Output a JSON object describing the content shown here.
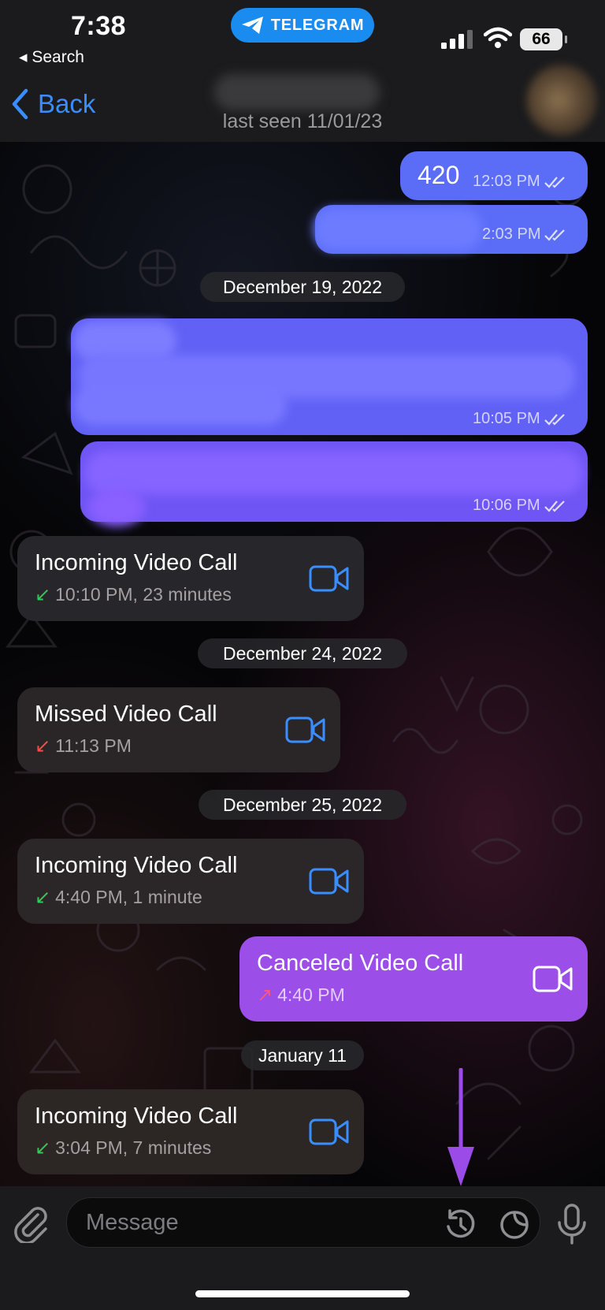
{
  "status_bar": {
    "time": "7:38",
    "back_app": "◂ Search",
    "app_pill": "TELEGRAM",
    "battery": "66"
  },
  "nav": {
    "back_label": "Back",
    "last_seen": "last seen 11/01/23"
  },
  "messages": {
    "m1": {
      "text": "420",
      "time": "12:03 PM"
    },
    "m2": {
      "time": "2:03 PM"
    },
    "m3": {
      "time": "10:05 PM"
    },
    "m4": {
      "time": "10:06 PM"
    }
  },
  "dates": [
    "December 19, 2022",
    "December 24, 2022",
    "December 25, 2022",
    "January 11"
  ],
  "calls": [
    {
      "title": "Incoming Video Call",
      "detail": "10:10 PM, 23 minutes",
      "arrow": "↙"
    },
    {
      "title": "Missed Video Call",
      "detail": "11:13 PM",
      "arrow": "↙"
    },
    {
      "title": "Incoming Video Call",
      "detail": "4:40 PM, 1 minute",
      "arrow": "↙"
    },
    {
      "title": "Canceled Video Call",
      "detail": "4:40 PM",
      "arrow": "↗"
    },
    {
      "title": "Incoming Video Call",
      "detail": "3:04 PM, 7 minutes",
      "arrow": "↙"
    }
  ],
  "input": {
    "placeholder": "Message"
  },
  "colors": {
    "accent": "#3a8dff",
    "outgoing": "#5b6cf7",
    "outgoing_purple": "#9b4ee8",
    "incoming": "#2b2628",
    "missed": "#ff4a4a",
    "received": "#34c759",
    "annotation_arrow": "#9a4be8"
  },
  "icons": [
    "back-chevron-icon",
    "telegram-plane-icon",
    "cellular-signal-icon",
    "wifi-icon",
    "double-check-icon",
    "video-camera-icon",
    "attach-paperclip-icon",
    "timer-icon",
    "sticker-icon",
    "microphone-icon"
  ]
}
